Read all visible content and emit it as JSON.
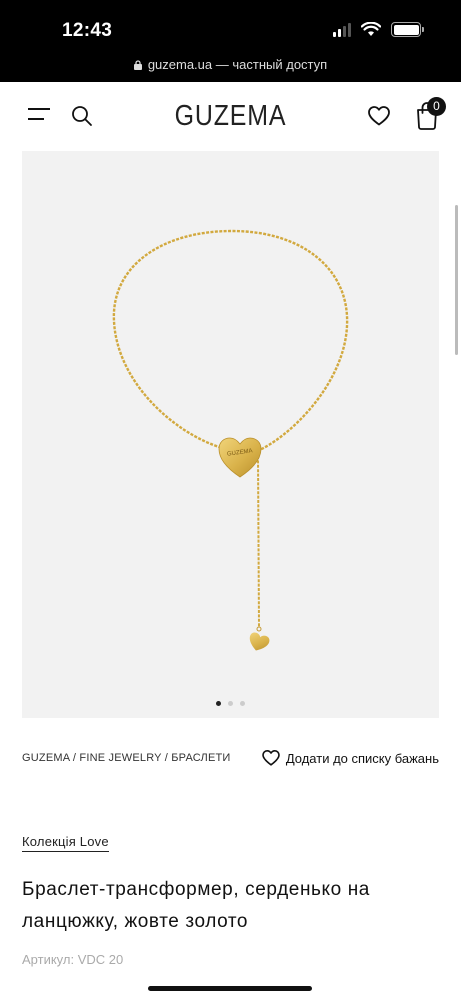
{
  "status": {
    "time": "12:43"
  },
  "browser": {
    "url": "guzema.ua",
    "url_suffix": "— частный доступ"
  },
  "header": {
    "logo": "GUZEMA",
    "cart_count": "0"
  },
  "gallery": {
    "pendant_engraving": "GUZEMA",
    "slide_count": 3,
    "active_slide": 1
  },
  "breadcrumb": {
    "text": "GUZEMA / FINE JEWELRY / БРАСЛЕТИ"
  },
  "wishlist": {
    "label": "Додати до списку бажань"
  },
  "product": {
    "collection": "Колекція Love",
    "title": "Браслет-трансформер, серденько на ланцюжку, жовте золото",
    "sku": "Артикул: VDC 20"
  },
  "colors": {
    "gold": "#d9b24a",
    "gallery_bg": "#f2f2f2"
  }
}
